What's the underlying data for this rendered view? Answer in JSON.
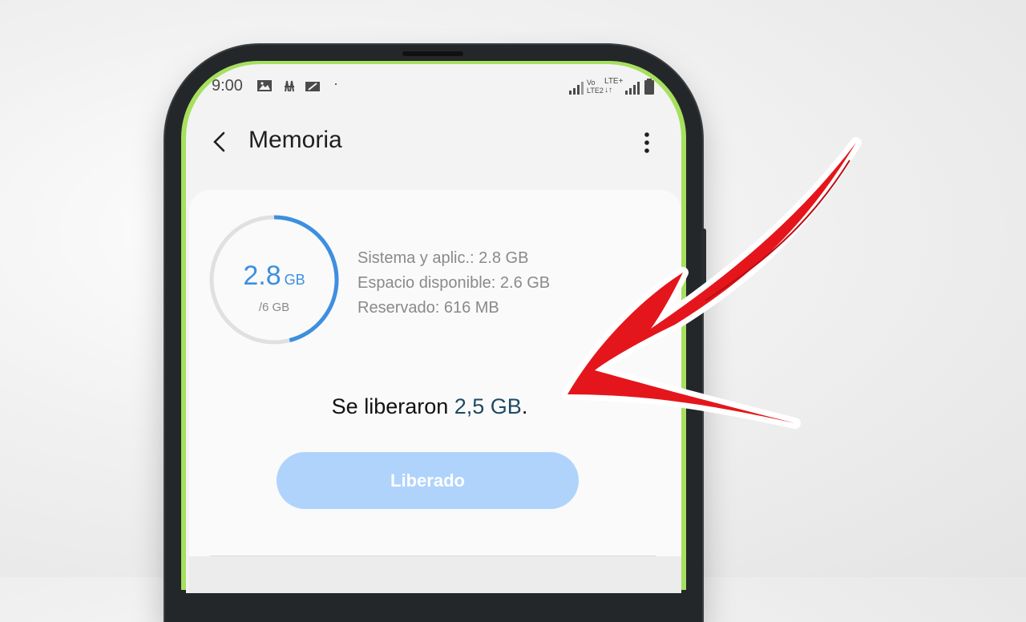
{
  "status_bar": {
    "time": "9:00",
    "left_icons": [
      "image-icon",
      "app-icon",
      "notification-icon",
      "dot-icon"
    ],
    "right_icons": [
      "signal-icon",
      "volte-icon",
      "lte-icon",
      "signal-icon",
      "battery-icon"
    ],
    "volte_label_top": "Vo",
    "volte_label_bottom": "LTE2",
    "lte_label": "LTE+"
  },
  "header": {
    "title": "Memoria",
    "back_icon": "back-icon",
    "menu_icon": "more-vert-icon"
  },
  "memory": {
    "used_value": "2.8",
    "used_unit": "GB",
    "total": "/6 GB",
    "used_fraction": 0.46,
    "details": [
      "Sistema y aplic.: 2.8 GB",
      "Espacio disponible: 2.6 GB",
      "Reservado: 616 MB"
    ]
  },
  "result": {
    "prefix": "Se liberaron ",
    "amount": "2,5 GB",
    "suffix": "."
  },
  "button": {
    "label": "Liberado"
  },
  "colors": {
    "accent": "#3d8fe0",
    "button_bg": "#afd3fb",
    "arrow": "#e4161c",
    "screen_rim": "#a6e05e"
  }
}
